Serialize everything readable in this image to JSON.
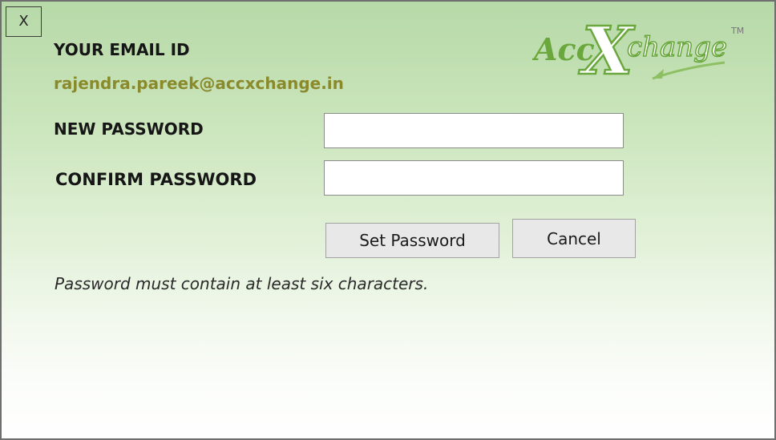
{
  "dialog": {
    "close_label": "X",
    "email_label": "YOUR EMAIL ID",
    "email_value": "rajendra.pareek@accxchange.in",
    "new_password_label": "NEW PASSWORD",
    "new_password_value": "",
    "confirm_password_label": "CONFIRM PASSWORD",
    "confirm_password_value": "",
    "set_password_label": "Set Password",
    "cancel_label": "Cancel",
    "hint": "Password must contain at least six characters."
  },
  "logo": {
    "prefix": "Acc",
    "big_letter": "X",
    "suffix": "change",
    "trademark": "TM"
  },
  "colors": {
    "email_text": "#8a8a2c",
    "logo_green": "#6aa83e",
    "gradient_top": "#b7d9a8",
    "gradient_bottom": "#ffffff"
  }
}
